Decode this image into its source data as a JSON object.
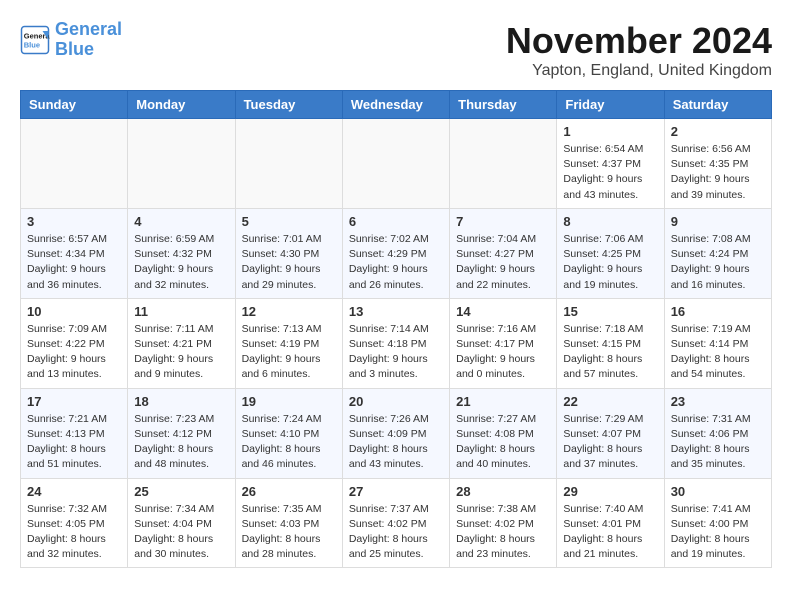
{
  "header": {
    "logo_line1": "General",
    "logo_line2": "Blue",
    "month": "November 2024",
    "location": "Yapton, England, United Kingdom"
  },
  "weekdays": [
    "Sunday",
    "Monday",
    "Tuesday",
    "Wednesday",
    "Thursday",
    "Friday",
    "Saturday"
  ],
  "weeks": [
    [
      {
        "day": "",
        "info": ""
      },
      {
        "day": "",
        "info": ""
      },
      {
        "day": "",
        "info": ""
      },
      {
        "day": "",
        "info": ""
      },
      {
        "day": "",
        "info": ""
      },
      {
        "day": "1",
        "info": "Sunrise: 6:54 AM\nSunset: 4:37 PM\nDaylight: 9 hours\nand 43 minutes."
      },
      {
        "day": "2",
        "info": "Sunrise: 6:56 AM\nSunset: 4:35 PM\nDaylight: 9 hours\nand 39 minutes."
      }
    ],
    [
      {
        "day": "3",
        "info": "Sunrise: 6:57 AM\nSunset: 4:34 PM\nDaylight: 9 hours\nand 36 minutes."
      },
      {
        "day": "4",
        "info": "Sunrise: 6:59 AM\nSunset: 4:32 PM\nDaylight: 9 hours\nand 32 minutes."
      },
      {
        "day": "5",
        "info": "Sunrise: 7:01 AM\nSunset: 4:30 PM\nDaylight: 9 hours\nand 29 minutes."
      },
      {
        "day": "6",
        "info": "Sunrise: 7:02 AM\nSunset: 4:29 PM\nDaylight: 9 hours\nand 26 minutes."
      },
      {
        "day": "7",
        "info": "Sunrise: 7:04 AM\nSunset: 4:27 PM\nDaylight: 9 hours\nand 22 minutes."
      },
      {
        "day": "8",
        "info": "Sunrise: 7:06 AM\nSunset: 4:25 PM\nDaylight: 9 hours\nand 19 minutes."
      },
      {
        "day": "9",
        "info": "Sunrise: 7:08 AM\nSunset: 4:24 PM\nDaylight: 9 hours\nand 16 minutes."
      }
    ],
    [
      {
        "day": "10",
        "info": "Sunrise: 7:09 AM\nSunset: 4:22 PM\nDaylight: 9 hours\nand 13 minutes."
      },
      {
        "day": "11",
        "info": "Sunrise: 7:11 AM\nSunset: 4:21 PM\nDaylight: 9 hours\nand 9 minutes."
      },
      {
        "day": "12",
        "info": "Sunrise: 7:13 AM\nSunset: 4:19 PM\nDaylight: 9 hours\nand 6 minutes."
      },
      {
        "day": "13",
        "info": "Sunrise: 7:14 AM\nSunset: 4:18 PM\nDaylight: 9 hours\nand 3 minutes."
      },
      {
        "day": "14",
        "info": "Sunrise: 7:16 AM\nSunset: 4:17 PM\nDaylight: 9 hours\nand 0 minutes."
      },
      {
        "day": "15",
        "info": "Sunrise: 7:18 AM\nSunset: 4:15 PM\nDaylight: 8 hours\nand 57 minutes."
      },
      {
        "day": "16",
        "info": "Sunrise: 7:19 AM\nSunset: 4:14 PM\nDaylight: 8 hours\nand 54 minutes."
      }
    ],
    [
      {
        "day": "17",
        "info": "Sunrise: 7:21 AM\nSunset: 4:13 PM\nDaylight: 8 hours\nand 51 minutes."
      },
      {
        "day": "18",
        "info": "Sunrise: 7:23 AM\nSunset: 4:12 PM\nDaylight: 8 hours\nand 48 minutes."
      },
      {
        "day": "19",
        "info": "Sunrise: 7:24 AM\nSunset: 4:10 PM\nDaylight: 8 hours\nand 46 minutes."
      },
      {
        "day": "20",
        "info": "Sunrise: 7:26 AM\nSunset: 4:09 PM\nDaylight: 8 hours\nand 43 minutes."
      },
      {
        "day": "21",
        "info": "Sunrise: 7:27 AM\nSunset: 4:08 PM\nDaylight: 8 hours\nand 40 minutes."
      },
      {
        "day": "22",
        "info": "Sunrise: 7:29 AM\nSunset: 4:07 PM\nDaylight: 8 hours\nand 37 minutes."
      },
      {
        "day": "23",
        "info": "Sunrise: 7:31 AM\nSunset: 4:06 PM\nDaylight: 8 hours\nand 35 minutes."
      }
    ],
    [
      {
        "day": "24",
        "info": "Sunrise: 7:32 AM\nSunset: 4:05 PM\nDaylight: 8 hours\nand 32 minutes."
      },
      {
        "day": "25",
        "info": "Sunrise: 7:34 AM\nSunset: 4:04 PM\nDaylight: 8 hours\nand 30 minutes."
      },
      {
        "day": "26",
        "info": "Sunrise: 7:35 AM\nSunset: 4:03 PM\nDaylight: 8 hours\nand 28 minutes."
      },
      {
        "day": "27",
        "info": "Sunrise: 7:37 AM\nSunset: 4:02 PM\nDaylight: 8 hours\nand 25 minutes."
      },
      {
        "day": "28",
        "info": "Sunrise: 7:38 AM\nSunset: 4:02 PM\nDaylight: 8 hours\nand 23 minutes."
      },
      {
        "day": "29",
        "info": "Sunrise: 7:40 AM\nSunset: 4:01 PM\nDaylight: 8 hours\nand 21 minutes."
      },
      {
        "day": "30",
        "info": "Sunrise: 7:41 AM\nSunset: 4:00 PM\nDaylight: 8 hours\nand 19 minutes."
      }
    ]
  ]
}
